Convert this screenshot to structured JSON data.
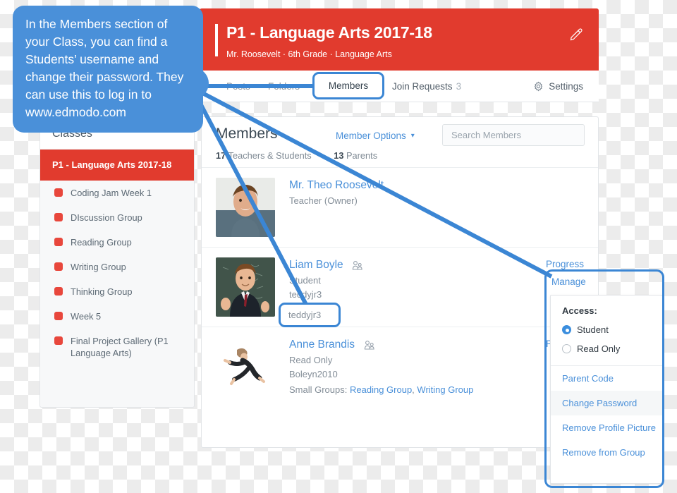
{
  "callout": {
    "text": "In the Members section of your Class, you can find a Students’ username and change their password. They can use this to log in to www.edmodo.com"
  },
  "banner": {
    "title": "P1 - Language Arts 2017-18",
    "subtitle": "Mr. Roosevelt · 6th Grade · Language Arts",
    "edit_icon": "pencil-icon",
    "bg_color": "#e13b2e"
  },
  "tabs": [
    {
      "label": "Posts",
      "active": false
    },
    {
      "label": "Folders",
      "active": false
    },
    {
      "label": "Members",
      "active": true
    },
    {
      "label": "Join Requests",
      "count": "3",
      "active": false
    },
    {
      "label": "Settings",
      "icon": "gear-icon",
      "active": false
    }
  ],
  "sidebar": {
    "header": "Classes",
    "active_class": "P1 - Language Arts 2017-18",
    "groups": [
      {
        "label": "Coding Jam Week 1",
        "color": "#e8473c"
      },
      {
        "label": "DIscussion Group",
        "color": "#e8473c"
      },
      {
        "label": "Reading Group",
        "color": "#e8473c"
      },
      {
        "label": "Writing Group",
        "color": "#e8473c"
      },
      {
        "label": "Thinking Group",
        "color": "#e8473c"
      },
      {
        "label": "Week 5",
        "color": "#e8473c"
      },
      {
        "label": "Final Project Gallery (P1 Language Arts)",
        "color": "#e8473c"
      }
    ]
  },
  "members": {
    "title": "Members",
    "member_options_label": "Member Options",
    "member_options_caret": "chevron-down-icon",
    "search_placeholder": "Search Members",
    "search_value": "",
    "counts": {
      "teachers_students_num": "17",
      "teachers_students_label": "Teachers & Students",
      "parents_num": "13",
      "parents_label": "Parents"
    },
    "rows": [
      {
        "name": "Mr. Theo Roosevelt",
        "role": "Teacher (Owner)",
        "username": "",
        "has_parent_icon": false,
        "progress_label": "",
        "avatar": "photo-man-smiling"
      },
      {
        "name": "Liam Boyle",
        "role": "Student",
        "username": "teddyjr3",
        "has_parent_icon": true,
        "progress_label": "Progress",
        "avatar": "photo-boy-thumbsup"
      },
      {
        "name": "Anne Brandis",
        "role": "Read Only",
        "username": "Boleyn2010",
        "has_parent_icon": true,
        "progress_label": "Progress",
        "small_groups_label": "Small Groups:",
        "small_groups": [
          "Reading Group",
          "Writing Group"
        ],
        "avatar": "photo-dancer-leap"
      }
    ]
  },
  "manage": {
    "link_label": "Manage",
    "access_label": "Access:",
    "options": [
      {
        "label": "Student",
        "selected": true
      },
      {
        "label": "Read Only",
        "selected": false
      }
    ],
    "actions": [
      {
        "label": "Parent Code",
        "hover": false
      },
      {
        "label": "Change Password",
        "hover": true
      },
      {
        "label": "Remove Profile Picture",
        "hover": false
      },
      {
        "label": "Remove from Group",
        "hover": false
      }
    ]
  },
  "annotation": {
    "accent_color": "#4a90d9",
    "highlight_members_tab": "Members",
    "highlight_username": "teddyjr3"
  }
}
